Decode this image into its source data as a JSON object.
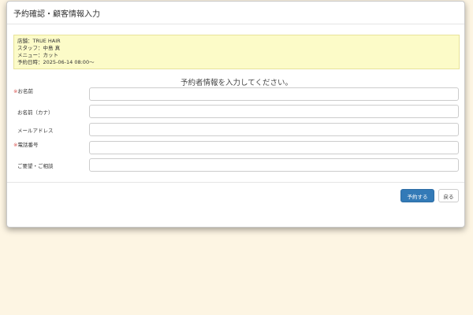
{
  "modal": {
    "title": "予約確認・顧客情報入力"
  },
  "summary": {
    "store": "店舗：TRUE HAIR",
    "staff": "スタッフ：中島 真",
    "menu": "メニュー：カット",
    "datetime": "予約日時：2025-06-14 08:00〜"
  },
  "form": {
    "intro": "予約者情報を入力してください。",
    "required_mark": "※",
    "name_label": "お名前",
    "name_value": "",
    "kana_label": "お名前（カナ）",
    "kana_value": "",
    "email_label": "メールアドレス",
    "email_value": "",
    "phone_label": "電話番号",
    "phone_value": "",
    "request_label": "ご要望・ご相談",
    "request_value": ""
  },
  "footer": {
    "reserve_label": "予約する",
    "back_label": "戻る"
  },
  "colors": {
    "page_background": "#fdf5e3",
    "summary_background": "#fcfbc8",
    "required": "#d9534f",
    "primary_button": "#337ab7"
  }
}
